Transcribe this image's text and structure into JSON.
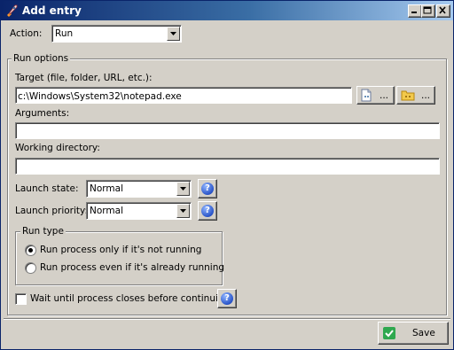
{
  "window": {
    "title": "Add entry",
    "icon": "rocket-icon"
  },
  "action": {
    "label": "Action:",
    "value": "Run"
  },
  "run_options": {
    "title": "Run options",
    "target": {
      "label": "Target (file, folder, URL, etc.):",
      "value": "c:\\Windows\\System32\\notepad.exe",
      "browse_file_label": "...",
      "browse_folder_label": "..."
    },
    "arguments": {
      "label": "Arguments:",
      "value": ""
    },
    "working_directory": {
      "label": "Working directory:",
      "value": ""
    },
    "launch_state": {
      "label": "Launch state:",
      "value": "Normal"
    },
    "launch_priority": {
      "label": "Launch priority:",
      "value": "Normal"
    },
    "run_type": {
      "title": "Run type",
      "options": [
        {
          "label": "Run process only if it's not running",
          "selected": true
        },
        {
          "label": "Run process even if it's already running",
          "selected": false
        }
      ]
    },
    "wait": {
      "label": "Wait until process closes before continuing",
      "checked": false
    },
    "help_symbol": "?"
  },
  "footer": {
    "save_label": "Save"
  },
  "colors": {
    "title_start": "#0a246a",
    "title_end": "#a6caf0",
    "face": "#d4d0c8",
    "save_check": "#2fa84f"
  }
}
